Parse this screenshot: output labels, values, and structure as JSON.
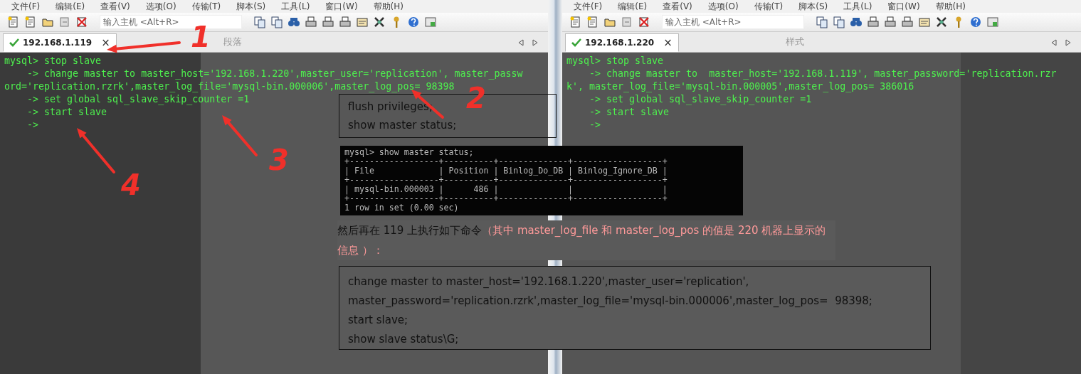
{
  "windows": [
    {
      "menu": [
        "文件(F)",
        "编辑(E)",
        "查看(V)",
        "选项(O)",
        "传输(T)",
        "脚本(S)",
        "工具(L)",
        "窗口(W)",
        "帮助(H)"
      ],
      "host_field": {
        "placeholder": "输入主机 <Alt+R>"
      },
      "tabs": [
        {
          "label": "192.168.1.119",
          "close": "×",
          "selected": true
        }
      ],
      "ribbon_label": "段落",
      "terminal": [
        "mysql> stop slave",
        "    -> change master to master_host='192.168.1.220',master_user='replication', master_passw",
        "ord='replication.rzrk',master_log_file='mysql-bin.000006',master_log_pos= 98398",
        "    -> set global sql_slave_skip_counter =1",
        "    -> start slave",
        "    ->"
      ]
    },
    {
      "menu": [
        "文件(F)",
        "编辑(E)",
        "查看(V)",
        "选项(O)",
        "传输(T)",
        "脚本(S)",
        "工具(L)",
        "窗口(W)",
        "帮助(H)"
      ],
      "host_field": {
        "placeholder": "输入主机 <Alt+R>"
      },
      "tabs": [
        {
          "label": "192.168.1.220",
          "close": "×",
          "selected": true
        }
      ],
      "ribbon_label": "样式",
      "terminal": [
        "mysql> stop slave",
        "    -> change master to  master_host='192.168.1.119', master_password='replication.rzr",
        "k', master_log_file='mysql-bin.000005',master_log_pos= 386016",
        "    -> set global sql_slave_skip_counter =1",
        "    -> start slave",
        "    ->"
      ]
    }
  ],
  "document": {
    "upper_box": [
      "flush privileges;",
      "show master status;"
    ],
    "status_screenshot": [
      "mysql> show master status;",
      "+------------------+----------+--------------+------------------+",
      "| File             | Position | Binlog_Do_DB | Binlog_Ignore_DB |",
      "+------------------+----------+--------------+------------------+",
      "| mysql-bin.000003 |      486 |              |                  |",
      "+------------------+----------+--------------+------------------+",
      "1 row in set (0.00 sec)"
    ],
    "sentence": [
      {
        "kind": "plain",
        "text": "然后再在 119 上执行如下命令"
      },
      {
        "kind": "note",
        "text": "（其中 master_log_file 和 master_log_pos 的值是 220 机器上显示的信息 ）："
      }
    ],
    "code_box": [
      "change master to master_host='192.168.1.220',master_user='replication',",
      "master_password='replication.rzrk',master_log_file='mysql-bin.000006',master_log_pos=  98398;",
      "start slave;",
      "show slave status\\G;"
    ]
  },
  "annotations": [
    "1",
    "2",
    "3",
    "4"
  ]
}
